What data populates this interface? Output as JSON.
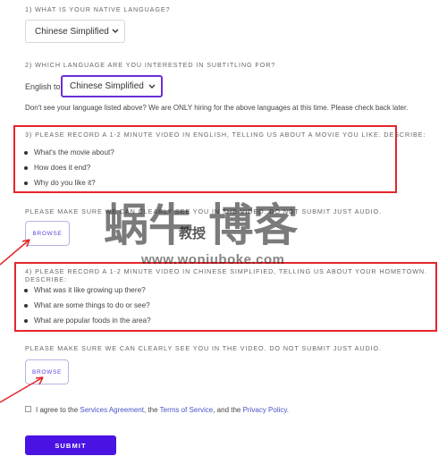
{
  "q1": {
    "label": "1) WHAT IS YOUR NATIVE LANGUAGE?",
    "select_value": "Chinese Simplified"
  },
  "q2": {
    "label": "2) WHICH LANGUAGE ARE YOU INTERESTED IN SUBTITLING FOR?",
    "prefix": "English to",
    "select_value": "Chinese Simplified",
    "note": "Don't see your language listed above? We are ONLY hiring for the above languages at this time. Please check back later."
  },
  "q3": {
    "label": "3) PLEASE RECORD A 1-2 MINUTE VIDEO IN ENGLISH, TELLING US ABOUT A MOVIE YOU LIKE. DESCRIBE:",
    "items": [
      "What's the movie about?",
      "How does it end?",
      "Why do you like it?"
    ]
  },
  "notice1": "PLEASE MAKE SURE WE CAN CLEARLY SEE YOU IN THE VIDEO. DO NOT SUBMIT JUST AUDIO.",
  "browse_label": "BROWSE",
  "q4": {
    "label": "4) PLEASE RECORD A 1-2 MINUTE VIDEO IN CHINESE SIMPLIFIED, TELLING US ABOUT YOUR HOMETOWN. DESCRIBE:",
    "items": [
      "What was it like growing up there?",
      "What are some things to do or see?",
      "What are popular foods in the area?"
    ]
  },
  "notice2": "PLEASE MAKE SURE WE CAN CLEARLY SEE YOU IN THE VIDEO. DO NOT SUBMIT JUST AUDIO.",
  "agree": {
    "prefix": "I agree to the",
    "services": "Services Agreement",
    "sep1": ", the",
    "terms": "Terms of Service",
    "sep2": ", and the",
    "privacy": "Privacy Policy",
    "end": "."
  },
  "submit_label": "SUBMIT",
  "watermark": {
    "big": "蜗牛 博客",
    "small": "教授",
    "url": "www.woniuboke.com"
  },
  "colors": {
    "accent": "#4a13e3",
    "highlight": "#e4262b",
    "link": "#4a55c6"
  }
}
